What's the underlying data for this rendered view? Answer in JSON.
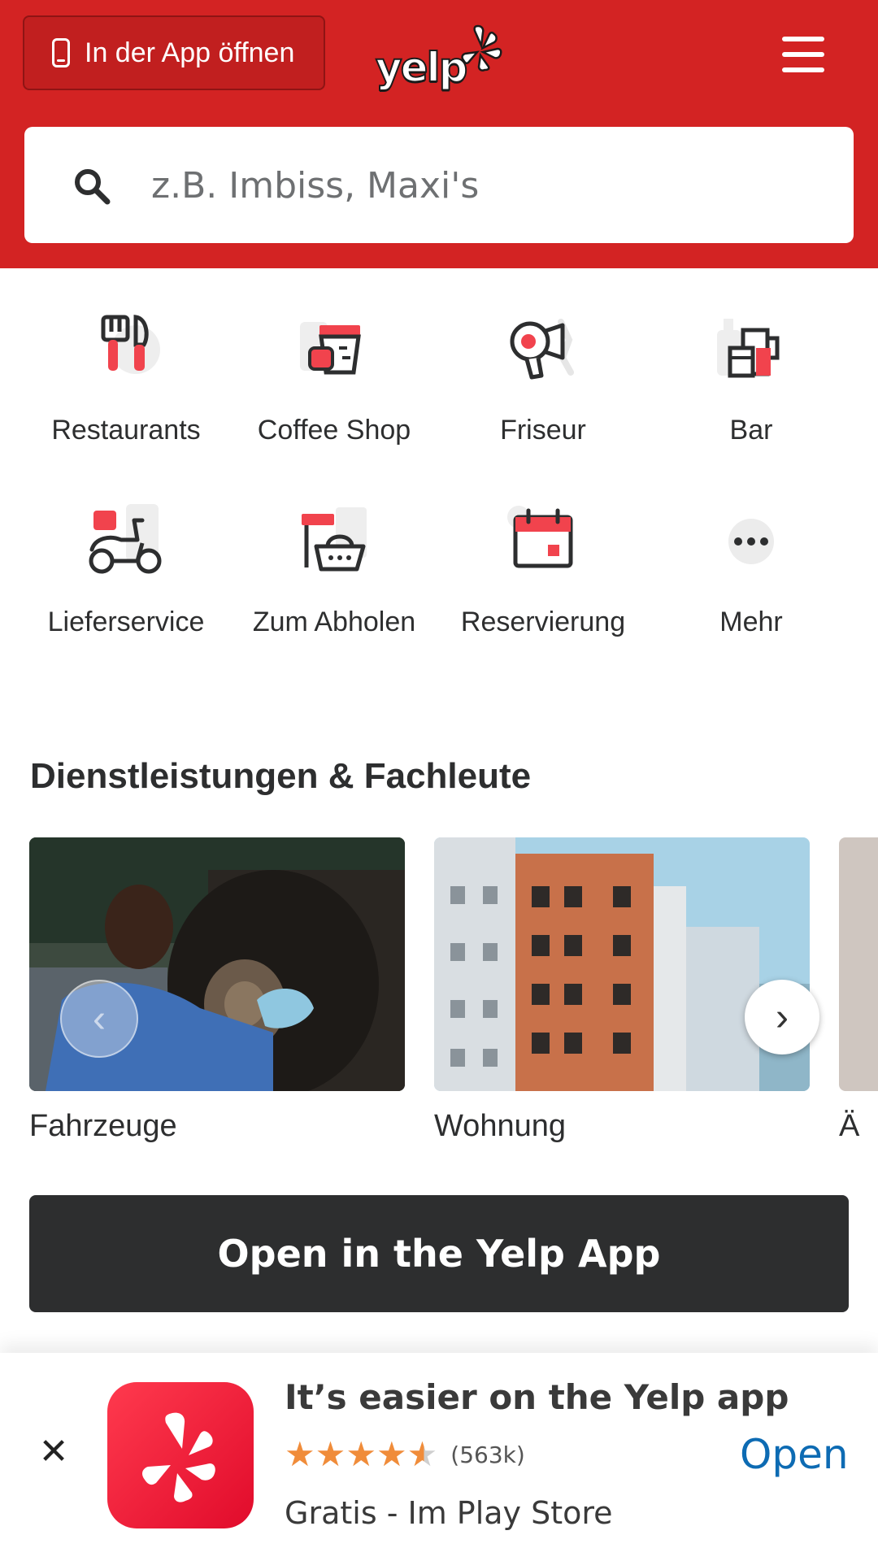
{
  "header": {
    "open_in_app_label": "In der App öffnen",
    "logo_text": "yelp",
    "brand_color": "#d32323"
  },
  "search": {
    "placeholder": "z.B. Imbiss, Maxi's",
    "value": ""
  },
  "categories": [
    {
      "label": "Restaurants",
      "icon": "utensils-icon"
    },
    {
      "label": "Coffee Shop",
      "icon": "coffee-cup-icon"
    },
    {
      "label": "Friseur",
      "icon": "hair-dryer-icon"
    },
    {
      "label": "Bar",
      "icon": "beer-mug-icon"
    },
    {
      "label": "Lieferservice",
      "icon": "scooter-icon"
    },
    {
      "label": "Zum Abholen",
      "icon": "takeout-basket-icon"
    },
    {
      "label": "Reservierung",
      "icon": "calendar-icon"
    },
    {
      "label": "Mehr",
      "icon": "more-dots-icon"
    }
  ],
  "services": {
    "title": "Dienstleistungen & Fachleute",
    "cards": [
      {
        "label": "Fahrzeuge"
      },
      {
        "label": "Wohnung"
      },
      {
        "label": "Ä"
      }
    ]
  },
  "cta": {
    "label": "Open in the Yelp App"
  },
  "app_banner": {
    "title": "It’s easier on the Yelp app",
    "rating": 4.5,
    "review_count": "(563k)",
    "subtitle": "Gratis - Im Play Store",
    "open_label": "Open",
    "close_symbol": "✕"
  }
}
